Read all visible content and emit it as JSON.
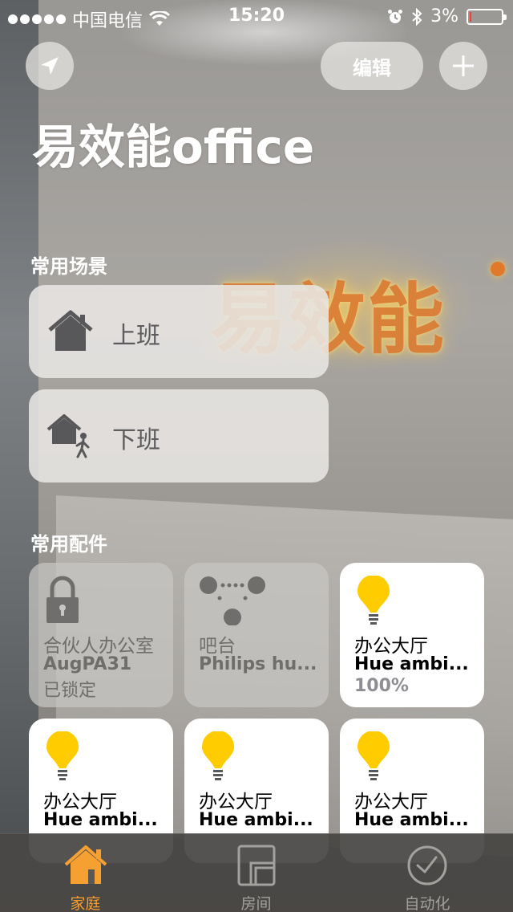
{
  "status_bar": {
    "carrier": "中国电信",
    "time": "15:20",
    "battery": "3%",
    "icons": [
      "signal-dots",
      "wifi-icon",
      "alarm-icon",
      "bluetooth-icon",
      "battery-icon"
    ],
    "battery_level_percent": 3
  },
  "header": {
    "location_icon": "location-arrow-icon",
    "edit_label": "编辑",
    "add_icon": "plus-icon",
    "home_name": "易效能office"
  },
  "background_logo_text": "易效能",
  "scenes": {
    "section_label": "常用场景",
    "items": [
      {
        "label": "上班",
        "icon": "house-icon"
      },
      {
        "label": "下班",
        "icon": "house-person-leaving-icon"
      }
    ]
  },
  "accessories": {
    "section_label": "常用配件",
    "items": [
      {
        "room": "合伙人办公室",
        "name": "AugPA31",
        "status": "已锁定",
        "icon": "lock-icon",
        "active": false
      },
      {
        "room": "吧台",
        "name": "Philips hu...",
        "status": "",
        "icon": "hue-bridge-icon",
        "active": false
      },
      {
        "room": "办公大厅",
        "name": "Hue ambi...",
        "status": "100%",
        "icon": "bulb-icon",
        "active": true
      },
      {
        "room": "办公大厅",
        "name": "Hue ambi...",
        "status": "",
        "icon": "bulb-icon",
        "active": true
      },
      {
        "room": "办公大厅",
        "name": "Hue ambi...",
        "status": "",
        "icon": "bulb-icon",
        "active": true
      },
      {
        "room": "办公大厅",
        "name": "Hue ambi...",
        "status": "",
        "icon": "bulb-icon",
        "active": true
      }
    ]
  },
  "tab_bar": {
    "tabs": [
      {
        "label": "家庭",
        "icon": "home-tab-icon",
        "active": true
      },
      {
        "label": "房间",
        "icon": "rooms-tab-icon",
        "active": false
      },
      {
        "label": "自动化",
        "icon": "clock-tab-icon",
        "active": false
      }
    ]
  },
  "colors": {
    "accent_active": "#f5a030",
    "bulb_yellow": "#ffcc00",
    "tab_inactive": "#a3a19e",
    "battery_low": "#ff3b30"
  }
}
